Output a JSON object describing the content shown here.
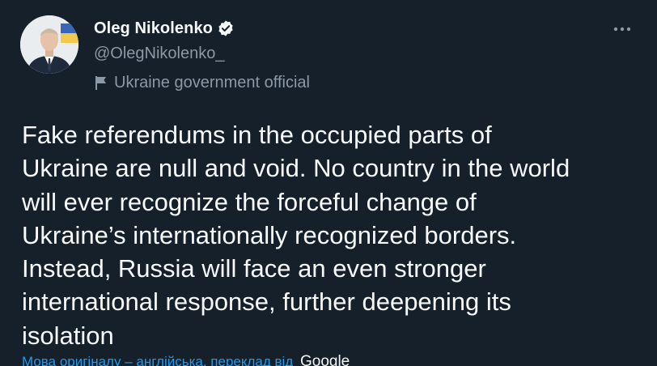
{
  "author": {
    "display_name": "Oleg Nikolenko",
    "handle": "@OlegNikolenko_",
    "label": "Ukraine government official",
    "verified": true
  },
  "icons": {
    "verified": "verified-badge-icon",
    "label": "flag-icon",
    "more": "more-options-icon"
  },
  "tweet": {
    "text": "Fake referendums in the occupied parts of\nUkraine are null and void. No country in the world\nwill ever recognize the forceful change of\nUkraine’s internationally recognized borders.\nInstead, Russia will face an even stronger\ninternational response, further deepening its\nisolation"
  },
  "translation": {
    "prefix": "Мова оригіналу – англійська, переклад від",
    "provider": "Google"
  },
  "colors": {
    "background": "#15202b",
    "primary_text": "#f7f9f9",
    "secondary_text": "#8b98a5",
    "accent": "#1d9bf0"
  }
}
